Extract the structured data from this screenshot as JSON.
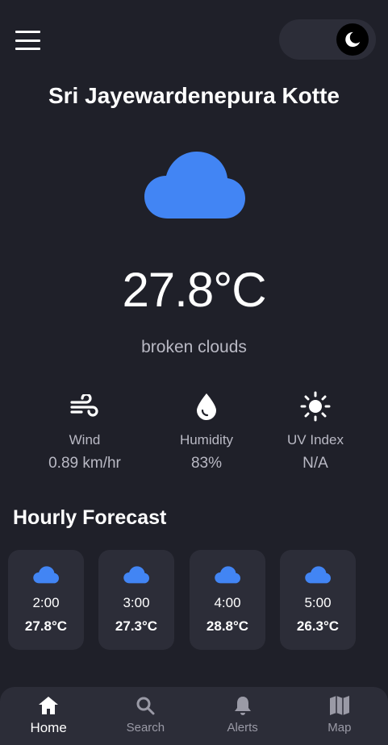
{
  "location": {
    "city": "Sri Jayewardenepura Kotte"
  },
  "current": {
    "temperature": "27.8°C",
    "description": "broken clouds",
    "icon": "cloud-icon"
  },
  "stats": [
    {
      "icon": "wind-icon",
      "label": "Wind",
      "value": "0.89 km/hr"
    },
    {
      "icon": "humidity-icon",
      "label": "Humidity",
      "value": "83%"
    },
    {
      "icon": "sun-icon",
      "label": "UV Index",
      "value": "N/A"
    }
  ],
  "hourly": {
    "title": "Hourly Forecast",
    "items": [
      {
        "time": "2:00",
        "temp": "27.8°C",
        "icon": "cloud-icon"
      },
      {
        "time": "3:00",
        "temp": "27.3°C",
        "icon": "cloud-icon"
      },
      {
        "time": "4:00",
        "temp": "28.8°C",
        "icon": "cloud-icon"
      },
      {
        "time": "5:00",
        "temp": "26.3°C",
        "icon": "cloud-icon"
      }
    ]
  },
  "nav": [
    {
      "label": "Home",
      "icon": "home-icon",
      "active": true
    },
    {
      "label": "Search",
      "icon": "search-icon",
      "active": false
    },
    {
      "label": "Alerts",
      "icon": "bell-icon",
      "active": false
    },
    {
      "label": "Map",
      "icon": "map-icon",
      "active": false
    }
  ],
  "colors": {
    "background": "#1f2029",
    "card": "#2c2d38",
    "accent": "#4285f4",
    "text_muted": "#b9b9c4"
  }
}
